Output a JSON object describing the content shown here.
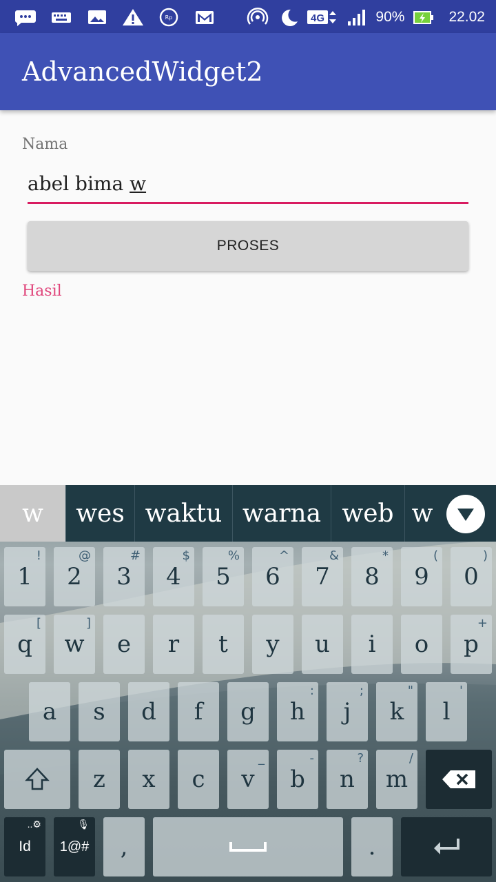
{
  "status": {
    "battery": "90%",
    "time": "22.02",
    "network": "4G"
  },
  "appbar": {
    "title": "AdvancedWidget2"
  },
  "form": {
    "label": "Nama",
    "value_before": "abel bima ",
    "value_underlined": "w",
    "button": "PROSES",
    "result_label": "Hasil"
  },
  "keyboard": {
    "suggestions": [
      "w",
      "wes",
      "waktu",
      "warna",
      "web",
      "w"
    ],
    "row1": [
      {
        "k": "1",
        "h": "!"
      },
      {
        "k": "2",
        "h": "@"
      },
      {
        "k": "3",
        "h": "#"
      },
      {
        "k": "4",
        "h": "$"
      },
      {
        "k": "5",
        "h": "%"
      },
      {
        "k": "6",
        "h": "^"
      },
      {
        "k": "7",
        "h": "&"
      },
      {
        "k": "8",
        "h": "*"
      },
      {
        "k": "9",
        "h": "("
      },
      {
        "k": "0",
        "h": ")"
      }
    ],
    "row2": [
      {
        "k": "q",
        "h": "["
      },
      {
        "k": "w",
        "h": "]"
      },
      {
        "k": "e",
        "h": ""
      },
      {
        "k": "r",
        "h": ""
      },
      {
        "k": "t",
        "h": ""
      },
      {
        "k": "y",
        "h": ""
      },
      {
        "k": "u",
        "h": ""
      },
      {
        "k": "i",
        "h": ""
      },
      {
        "k": "o",
        "h": ""
      },
      {
        "k": "p",
        "h": "+"
      }
    ],
    "row3": [
      {
        "k": "a",
        "h": ""
      },
      {
        "k": "s",
        "h": ""
      },
      {
        "k": "d",
        "h": ""
      },
      {
        "k": "f",
        "h": ""
      },
      {
        "k": "g",
        "h": ""
      },
      {
        "k": "h",
        "h": ":"
      },
      {
        "k": "j",
        "h": ";"
      },
      {
        "k": "k",
        "h": "\""
      },
      {
        "k": "l",
        "h": "'"
      }
    ],
    "row4": [
      {
        "k": "z",
        "h": ""
      },
      {
        "k": "x",
        "h": ""
      },
      {
        "k": "c",
        "h": ""
      },
      {
        "k": "v",
        "h": "_"
      },
      {
        "k": "b",
        "h": "-"
      },
      {
        "k": "n",
        "h": "?"
      },
      {
        "k": "m",
        "h": "/"
      }
    ],
    "lang_key": "Id",
    "symbols_key": "1@#",
    "comma": ",",
    "period": "."
  },
  "colors": {
    "status_bar": "#303f9f",
    "app_bar": "#3f51b5",
    "accent": "#d81b60"
  }
}
